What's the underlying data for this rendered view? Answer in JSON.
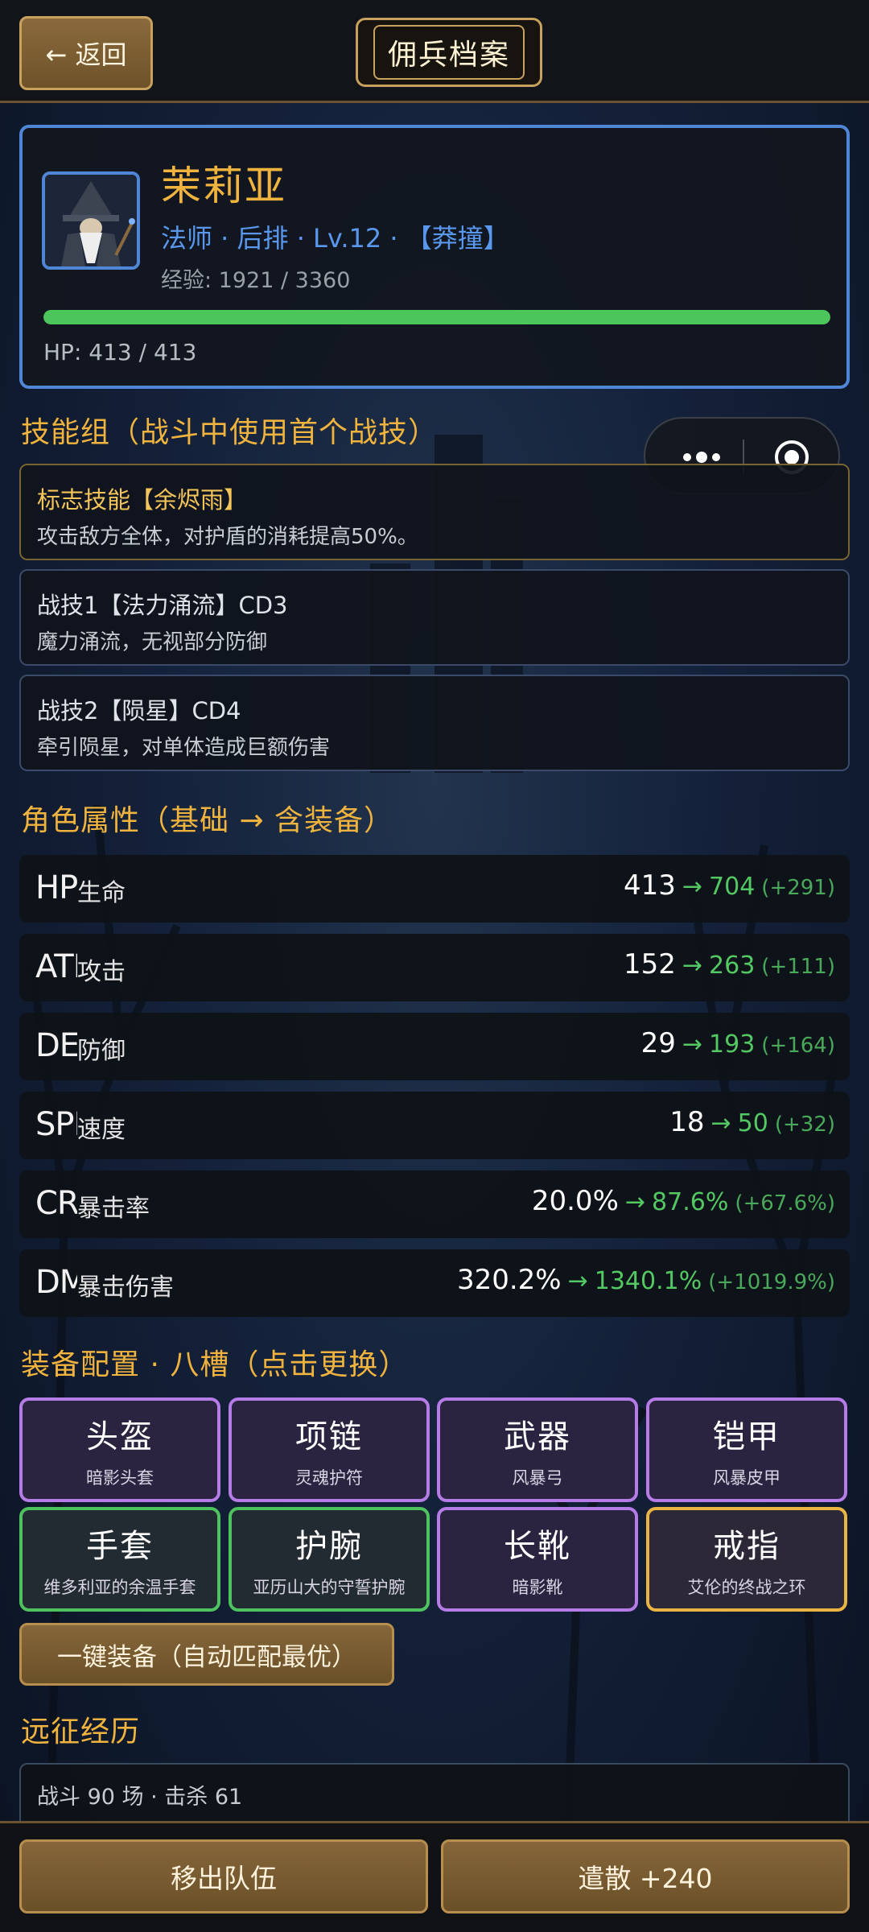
{
  "header": {
    "back_label": "← 返回",
    "title": "佣兵档案"
  },
  "hero": {
    "name": "茉莉亚",
    "meta": "法师 · 后排 · Lv.12 · 【莽撞】",
    "exp": "经验: 1921 / 3360",
    "hp_text": "HP: 413 / 413",
    "hp_fraction": 1.0,
    "portrait_icon": "wizard-portrait"
  },
  "skills_section": {
    "title": "技能组（战斗中使用首个战技）",
    "items": [
      {
        "name": "标志技能【余烬雨】",
        "desc": "攻击敌方全体，对护盾的消耗提高50%。"
      },
      {
        "name": "战技1【法力涌流】CD3",
        "desc": "魔力涌流，无视部分防御"
      },
      {
        "name": "战技2【陨星】CD4",
        "desc": "牵引陨星，对单体造成巨额伤害"
      }
    ]
  },
  "capsule": {
    "more_icon": "more-dots-icon",
    "close_icon": "target-icon"
  },
  "stats_section": {
    "title": "角色属性（基础 → 含装备）",
    "rows": [
      {
        "abbr": "HP",
        "name": "生命",
        "base": "413",
        "arrow": "→",
        "equipped": "704",
        "bonus": "(+291)"
      },
      {
        "abbr": "ATK",
        "name": "攻击",
        "base": "152",
        "arrow": "→",
        "equipped": "263",
        "bonus": "(+111)"
      },
      {
        "abbr": "DEF",
        "name": "防御",
        "base": "29",
        "arrow": "→",
        "equipped": "193",
        "bonus": "(+164)"
      },
      {
        "abbr": "SPD",
        "name": "速度",
        "base": "18",
        "arrow": "→",
        "equipped": "50",
        "bonus": "(+32)"
      },
      {
        "abbr": "CRI",
        "name": "暴击率",
        "base": "20.0%",
        "arrow": "→",
        "equipped": "87.6%",
        "bonus": "(+67.6%)"
      },
      {
        "abbr": "DMG",
        "name": "暴击伤害",
        "base": "320.2%",
        "arrow": "→",
        "equipped": "1340.1%",
        "bonus": "(+1019.9%)"
      }
    ]
  },
  "equipment_section": {
    "title": "装备配置 · 八槽（点击更换）",
    "slots": [
      {
        "slot": "头盔",
        "item": "暗影头套",
        "rarity": "epic"
      },
      {
        "slot": "项链",
        "item": "灵魂护符",
        "rarity": "epic"
      },
      {
        "slot": "武器",
        "item": "风暴弓",
        "rarity": "epic"
      },
      {
        "slot": "铠甲",
        "item": "风暴皮甲",
        "rarity": "epic"
      },
      {
        "slot": "手套",
        "item": "维多利亚的余温手套",
        "rarity": "uncommon"
      },
      {
        "slot": "护腕",
        "item": "亚历山大的守誓护腕",
        "rarity": "uncommon"
      },
      {
        "slot": "长靴",
        "item": "暗影靴",
        "rarity": "epic"
      },
      {
        "slot": "戒指",
        "item": "艾伦的终战之环",
        "rarity": "legendary"
      }
    ],
    "rarity_colors": {
      "epic": "#b57be6",
      "uncommon": "#4fc260",
      "legendary": "#eab443"
    },
    "auto_equip_label": "一键装备（自动匹配最优）"
  },
  "history_section": {
    "title": "远征经历",
    "summary": "战斗 90 场 · 击杀 61"
  },
  "footer": {
    "remove_label": "移出队伍",
    "dismiss_label": "遣散 +240"
  }
}
